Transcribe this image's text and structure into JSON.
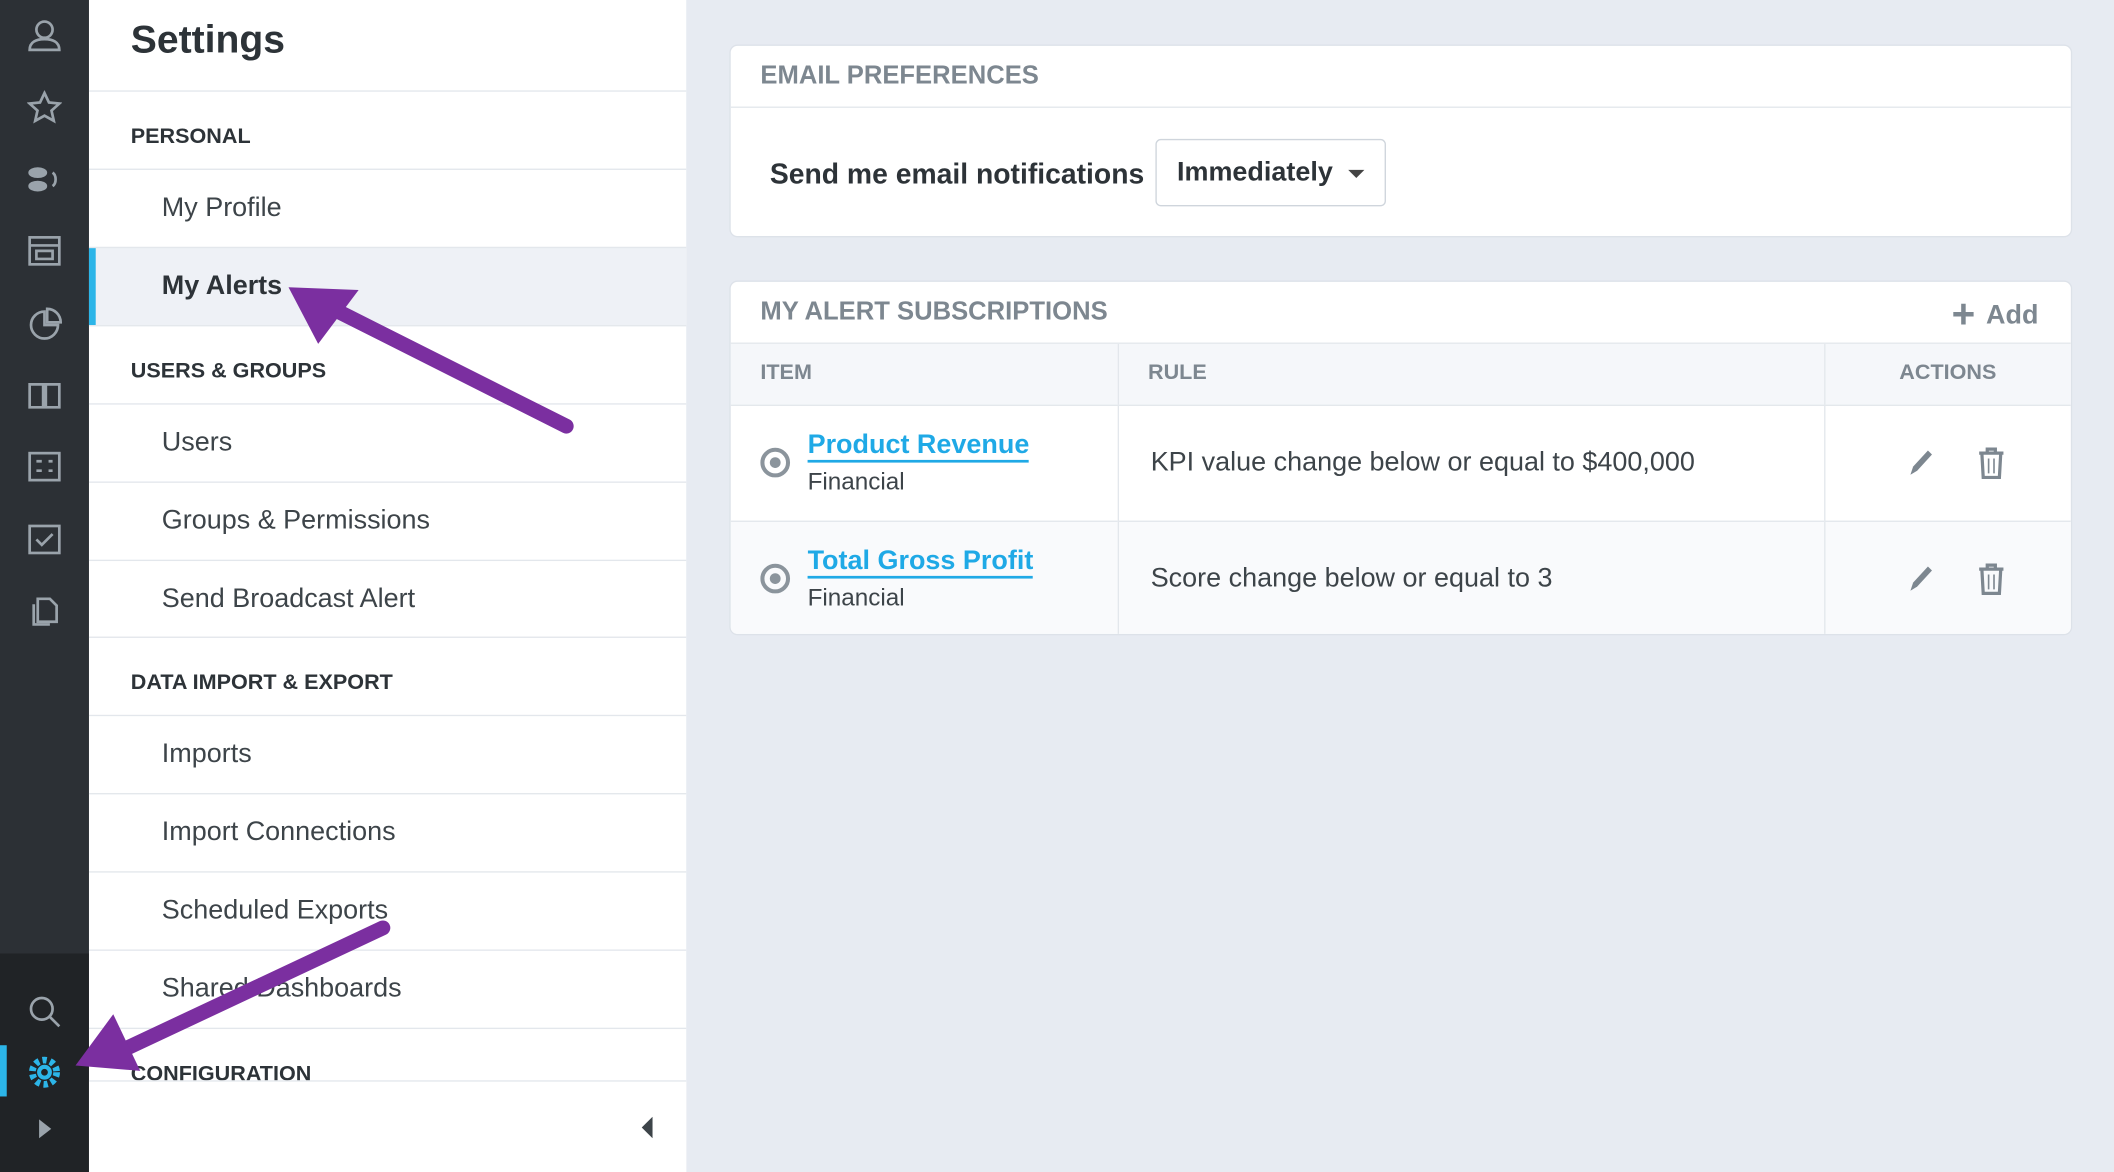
{
  "rail": {
    "icons": [
      "user-icon",
      "star-icon",
      "people-icon",
      "dashboard-icon",
      "pie-chart-icon",
      "book-icon",
      "scorecard-icon",
      "checkbox-icon",
      "documents-icon"
    ],
    "bottom_icons": [
      "search-icon",
      "gear-icon",
      "expand-icon"
    ],
    "accent": "#2cb5e8"
  },
  "settings": {
    "title": "Settings",
    "sections": [
      {
        "header": "PERSONAL",
        "items": [
          "My Profile",
          "My Alerts"
        ]
      },
      {
        "header": "USERS & GROUPS",
        "items": [
          "Users",
          "Groups & Permissions",
          "Send Broadcast Alert"
        ]
      },
      {
        "header": "DATA IMPORT & EXPORT",
        "items": [
          "Imports",
          "Import Connections",
          "Scheduled Exports",
          "Shared Dashboards"
        ]
      },
      {
        "header": "CONFIGURATION",
        "items": []
      }
    ],
    "selected": "My Alerts"
  },
  "email": {
    "header": "EMAIL PREFERENCES",
    "label": "Send me email notifications",
    "select_value": "Immediately"
  },
  "alerts": {
    "header": "MY ALERT SUBSCRIPTIONS",
    "add_label": "Add",
    "columns": [
      "ITEM",
      "RULE",
      "ACTIONS"
    ],
    "rows": [
      {
        "item": "Product Revenue",
        "category": "Financial",
        "rule": "KPI value change below or equal to $400,000"
      },
      {
        "item": "Total Gross Profit",
        "category": "Financial",
        "rule": "Score change below or equal to 3"
      }
    ]
  },
  "annotation_color": "#7b2fa0"
}
